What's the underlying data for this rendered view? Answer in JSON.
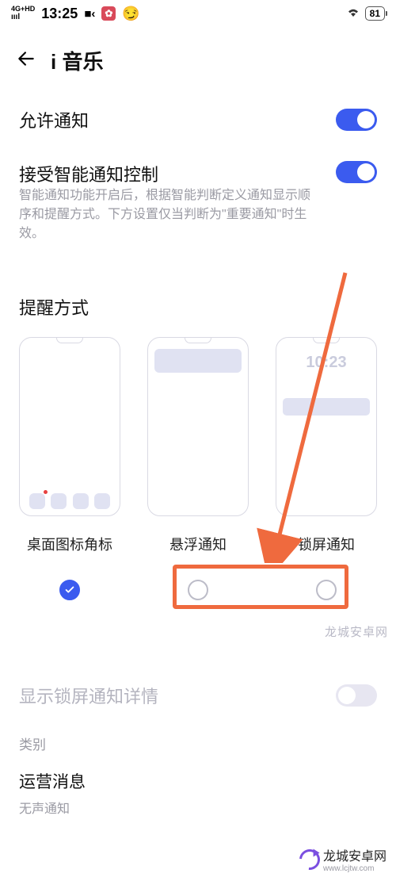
{
  "status": {
    "network": "4G+HD",
    "time": "13:25",
    "battery": "81"
  },
  "nav": {
    "title": "i 音乐"
  },
  "allow_notif": {
    "label": "允许通知",
    "on": true
  },
  "smart_control": {
    "label": "接受智能通知控制",
    "desc": "智能通知功能开启后，根据智能判断定义通知显示顺序和提醒方式。下方设置仅当判断为\"重要通知\"时生效。",
    "on": true
  },
  "remind": {
    "title": "提醒方式",
    "options": [
      {
        "label": "桌面图标角标",
        "checked": true
      },
      {
        "label": "悬浮通知",
        "checked": false
      },
      {
        "label": "锁屏通知",
        "checked": false
      }
    ],
    "lockscreen_time": "10:23"
  },
  "ls_detail": {
    "label": "显示锁屏通知详情",
    "on": false
  },
  "category": {
    "title": "类别",
    "item_title": "运营消息",
    "item_sub": "无声通知"
  },
  "watermark": {
    "top": "龙城安卓网",
    "brand": "龙城安卓网",
    "url": "www.lcjtw.com"
  }
}
